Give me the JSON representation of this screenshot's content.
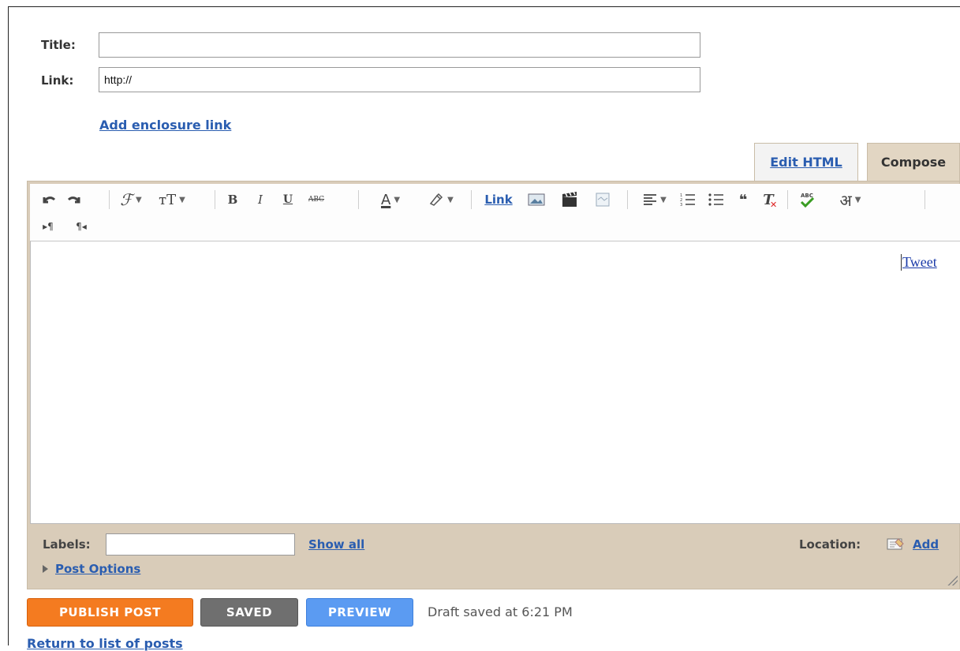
{
  "form": {
    "title_label": "Title:",
    "title_value": "",
    "link_label": "Link:",
    "link_value": "http://",
    "enclosure_link": "Add enclosure link"
  },
  "tabs": [
    {
      "label": "Edit HTML",
      "active": false
    },
    {
      "label": "Compose",
      "active": true
    }
  ],
  "toolbar": {
    "undo_icon": "undo-icon",
    "redo_icon": "redo-icon",
    "font_glyph": "ℱ",
    "font_size_glyph": "тT",
    "bold": "B",
    "italic": "I",
    "underline": "U",
    "strike": "ABC",
    "text_color": "A",
    "link": "Link",
    "quote": "❝",
    "clear_format": "T",
    "spellcheck": "ABC",
    "transliterate": "अ",
    "ltr": "▸¶",
    "rtl": "¶◂"
  },
  "content": {
    "tweet_link": "Tweet"
  },
  "footer": {
    "labels_label": "Labels:",
    "labels_value": "",
    "show_all": "Show all",
    "location_label": "Location:",
    "location_add": "Add",
    "post_options": "Post Options"
  },
  "actions": {
    "publish": "PUBLISH POST",
    "saved": "SAVED",
    "preview": "PREVIEW",
    "draft_status": "Draft saved at 6:21 PM",
    "return_link": "Return to list of posts"
  },
  "colors": {
    "publish": "#f47b20",
    "saved": "#6f6f6f",
    "preview": "#5b9bf2",
    "editor_bg": "#d9ccb9",
    "link": "#2a5db0"
  }
}
